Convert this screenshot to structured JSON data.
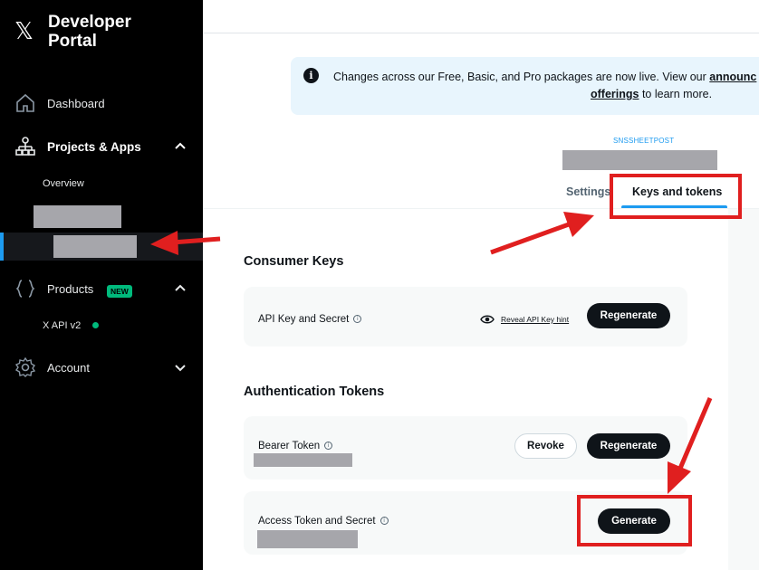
{
  "sidebar": {
    "brand_line1": "Developer",
    "brand_line2": "Portal",
    "logo_glyph": "𝕏",
    "items": [
      {
        "label": "Dashboard",
        "icon": "home-icon"
      },
      {
        "label": "Projects & Apps",
        "icon": "projects-icon"
      },
      {
        "label": "Products",
        "icon": "braces-icon",
        "badge": "NEW"
      },
      {
        "label": "Account",
        "icon": "gear-icon"
      }
    ],
    "project_sub": {
      "overview": "Overview"
    },
    "products_sub": {
      "api": "X API v2"
    }
  },
  "banner": {
    "icon_glyph": "i",
    "text_line1": "Changes across our Free, Basic, and Pro packages are now live. View our",
    "link1": "announc",
    "link2": "offerings",
    "text_line2": " to learn more."
  },
  "app": {
    "caption": "SNSSHEETPOST"
  },
  "tabs": [
    {
      "label": "Settings",
      "active": false
    },
    {
      "label": "Keys and tokens",
      "active": true
    }
  ],
  "consumer_keys": {
    "title": "Consumer Keys",
    "row_label": "API Key and Secret",
    "reveal": "Reveal API Key hint",
    "regenerate": "Regenerate"
  },
  "auth_tokens": {
    "title": "Authentication Tokens",
    "bearer_label": "Bearer Token",
    "revoke": "Revoke",
    "regenerate": "Regenerate",
    "access_label": "Access Token and Secret",
    "generate": "Generate"
  },
  "colors": {
    "accent": "#1d9bf0",
    "annotation": "#e01f1f",
    "sidebar_bg": "#000000",
    "banner_bg": "#e8f5fd"
  }
}
